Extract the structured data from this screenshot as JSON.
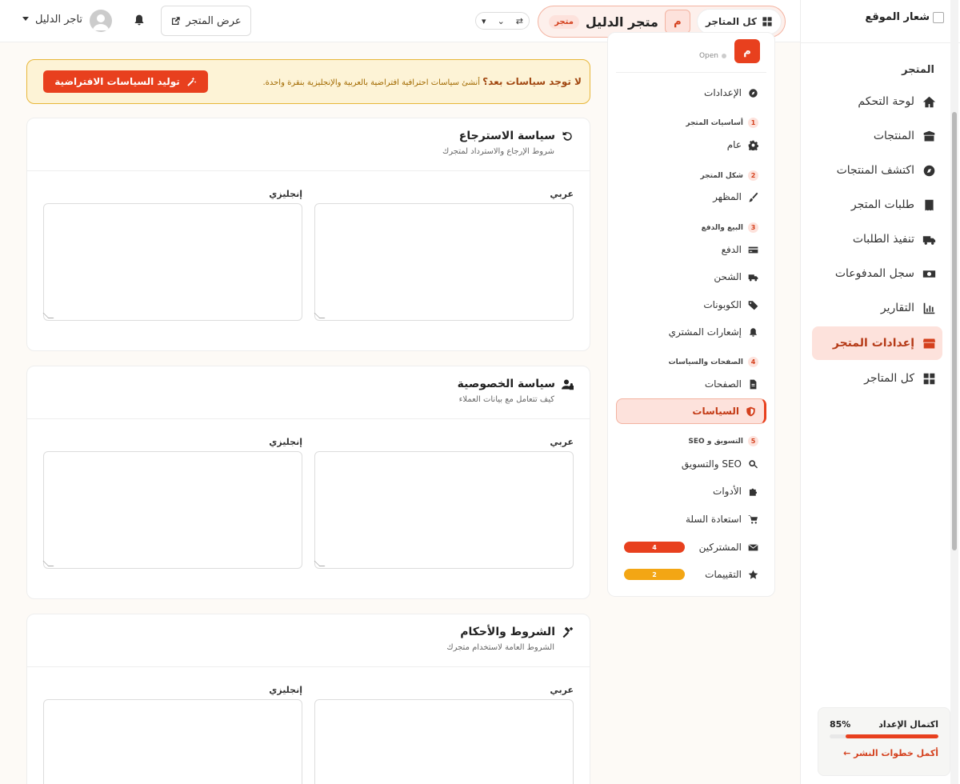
{
  "sidebar": {
    "logo_text": "شعار الموقع",
    "section_label": "المتجر",
    "items": [
      {
        "label": "لوحة التحكم",
        "icon": "home-icon"
      },
      {
        "label": "المنتجات",
        "icon": "box-icon"
      },
      {
        "label": "اكتشف المنتجات",
        "icon": "compass-icon"
      },
      {
        "label": "طلبات المتجر",
        "icon": "receipt-icon"
      },
      {
        "label": "تنفيذ الطلبات",
        "icon": "truck-icon"
      },
      {
        "label": "سجل المدفوعات",
        "icon": "money-icon"
      },
      {
        "label": "التقارير",
        "icon": "chart-icon"
      },
      {
        "label": "إعدادات المتجر",
        "icon": "store-icon",
        "active": true
      },
      {
        "label": "كل المتاجر",
        "icon": "grid-icon"
      }
    ],
    "progress": {
      "title": "اكتمال الإعداد",
      "percent_label": "85%",
      "fraction": 0.85,
      "link": "أكمل خطوات النشر ←"
    }
  },
  "topbar": {
    "all_stores_label": "كل المتاجر",
    "store_avatar_letter": "م",
    "store_name": "متجر الدليل",
    "store_tag": "متجر",
    "view_store_label": "عرض المتجر",
    "user_name": "تاجر الدليل"
  },
  "settings_panel": {
    "avatar_letter": "م",
    "status_label": "Open",
    "items_top": [
      {
        "label": "الإعدادات",
        "icon": "compass-icon"
      }
    ],
    "groups": [
      {
        "num": "1",
        "label": "أساسيات المتجر",
        "items": [
          {
            "label": "عام",
            "icon": "gear-icon"
          }
        ]
      },
      {
        "num": "2",
        "label": "شكل المتجر",
        "items": [
          {
            "label": "المظهر",
            "icon": "brush-icon"
          }
        ]
      },
      {
        "num": "3",
        "label": "البيع والدفع",
        "items": [
          {
            "label": "الدفع",
            "icon": "card-icon"
          },
          {
            "label": "الشحن",
            "icon": "truck-icon"
          },
          {
            "label": "الكوبونات",
            "icon": "tags-icon"
          },
          {
            "label": "إشعارات المشتري",
            "icon": "bell-icon"
          }
        ]
      },
      {
        "num": "4",
        "label": "الصفحات والسياسات",
        "items": [
          {
            "label": "الصفحات",
            "icon": "file-icon"
          },
          {
            "label": "السياسات",
            "icon": "shield-icon",
            "active": true
          }
        ]
      },
      {
        "num": "5",
        "label": "التسويق و SEO",
        "items": [
          {
            "label": "SEO والتسويق",
            "icon": "search-icon"
          },
          {
            "label": "الأدوات",
            "icon": "puzzle-icon"
          },
          {
            "label": "استعادة السلة",
            "icon": "cart-icon"
          },
          {
            "label": "المشتركين",
            "icon": "envelope-icon",
            "badge": "4",
            "badge_color": "#e8401e"
          },
          {
            "label": "التقييمات",
            "icon": "star-icon",
            "badge": "2",
            "badge_color": "#f3a614"
          }
        ]
      }
    ]
  },
  "banner": {
    "title": "لا توجد سياسات بعد؟",
    "text": "أنشئ سياسات احترافية افتراضية بالعربية والإنجليزية بنقرة واحدة.",
    "button_label": "توليد السياسات الافتراضية"
  },
  "policies": [
    {
      "title": "سياسة الاسترجاع",
      "subtitle": "شروط الإرجاع والاسترداد لمتجرك",
      "icon": "undo-icon",
      "label_ar": "عربي",
      "label_en": "إنجليزي"
    },
    {
      "title": "سياسة الخصوصية",
      "subtitle": "كيف تتعامل مع بيانات العملاء",
      "icon": "user-lock-icon",
      "label_ar": "عربي",
      "label_en": "إنجليزي"
    },
    {
      "title": "الشروط والأحكام",
      "subtitle": "الشروط العامة لاستخدام متجرك",
      "icon": "gavel-icon",
      "label_ar": "عربي",
      "label_en": "إنجليزي"
    }
  ],
  "colors": {
    "accent": "#e8401e",
    "warning": "#f3a614",
    "banner_bg": "#fdf3d6"
  }
}
